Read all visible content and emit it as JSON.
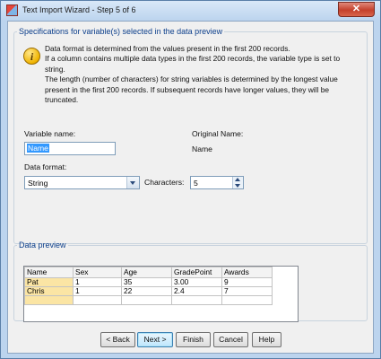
{
  "window": {
    "title": "Text Import Wizard - Step 5 of 6",
    "close_glyph": "✕"
  },
  "spec_group": {
    "legend": "Specifications for variable(s) selected in the data preview",
    "info_icon": "info-icon",
    "info_lines": [
      "Data format is determined from the values present in the first 200 records.",
      "If a column contains multiple data types in the first 200 records, the variable type is set to string.",
      "The length (number of characters) for string variables is determined by the longest value present in the first 200 records. If subsequent records have longer values, they will be truncated."
    ],
    "variable_name_label": "Variable name:",
    "variable_name_value": "Name",
    "original_name_label": "Original Name:",
    "original_name_value": "Name",
    "data_format_label": "Data format:",
    "data_format_value": "String",
    "characters_label": "Characters:",
    "characters_value": "5"
  },
  "preview_group": {
    "legend": "Data preview",
    "columns": [
      "Name",
      "Sex",
      "Age",
      "GradePoint",
      "Awards"
    ],
    "rows": [
      [
        "Pat",
        "1",
        "35",
        "3.00",
        "9"
      ],
      [
        "Chris",
        "1",
        "22",
        "2.4",
        "7"
      ],
      [
        "",
        "",
        "",
        "",
        ""
      ]
    ]
  },
  "buttons": {
    "back": "< Back",
    "next": "Next >",
    "finish": "Finish",
    "cancel": "Cancel",
    "help": "Help"
  }
}
